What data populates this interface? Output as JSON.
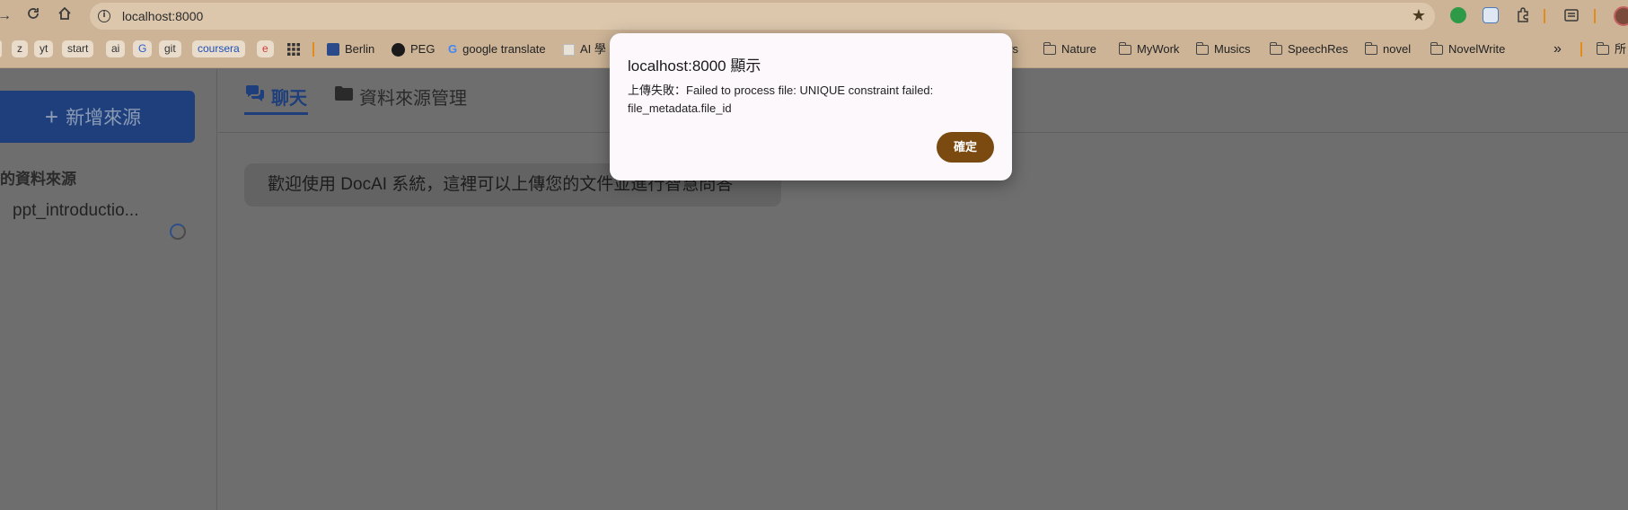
{
  "browser": {
    "url": "localhost:8000",
    "bookmarks": {
      "chips": [
        "z",
        "yt",
        "start",
        "ai",
        "G",
        "git",
        "coursera",
        "e"
      ],
      "links": [
        "Berlin",
        "PEG",
        "google translate",
        "AI 學"
      ],
      "folders": [
        "ers",
        "Nature",
        "MyWork",
        "Musics",
        "SpeechRes",
        "novel",
        "NovelWrite"
      ],
      "overflow": "»",
      "trailing": "所"
    }
  },
  "sidebar": {
    "add_label": "新增來源",
    "heading": "的資料來源",
    "items": [
      {
        "label": "ppt_introductio..."
      }
    ]
  },
  "tabs": [
    {
      "label": "聊天",
      "icon": "chat-icon"
    },
    {
      "label": "資料來源管理",
      "icon": "folder-icon"
    }
  ],
  "chat": {
    "welcome": "歡迎使用 DocAI 系統，這裡可以上傳您的文件並進行智慧問答"
  },
  "dialog": {
    "title": "localhost:8000 顯示",
    "message": "上傳失敗：Failed to process file: UNIQUE constraint failed: file_metadata.file_id",
    "ok_label": "確定"
  },
  "colors": {
    "primary": "#1e3f7c",
    "dialog_button": "#7a4a10",
    "chrome": "#cdb497"
  }
}
